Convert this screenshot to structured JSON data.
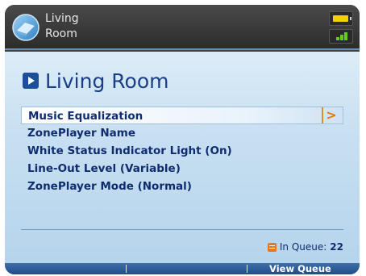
{
  "header": {
    "title_line1": "Living",
    "title_line2": "Room",
    "icons": [
      "room-icon",
      "battery-icon",
      "signal-icon"
    ],
    "battery_color": "#f5d000",
    "signal_color": "#6acb1e"
  },
  "page_title": "Living Room",
  "menu": {
    "items": [
      {
        "label": "Music Equalization",
        "selected": true,
        "has_submenu": true
      },
      {
        "label": "ZonePlayer Name"
      },
      {
        "label": "White Status Indicator Light (On)"
      },
      {
        "label": "Line-Out Level (Variable)"
      },
      {
        "label": "ZonePlayer Mode (Normal)"
      }
    ],
    "chevron": ">"
  },
  "queue": {
    "label": "In Queue:",
    "count": "22"
  },
  "softkeys": {
    "left": "",
    "middle": "",
    "right": "View Queue"
  },
  "colors": {
    "accent": "#1a3f86",
    "selection_arrow": "#e07a10",
    "softkey_bar": "#1f4c8a"
  }
}
